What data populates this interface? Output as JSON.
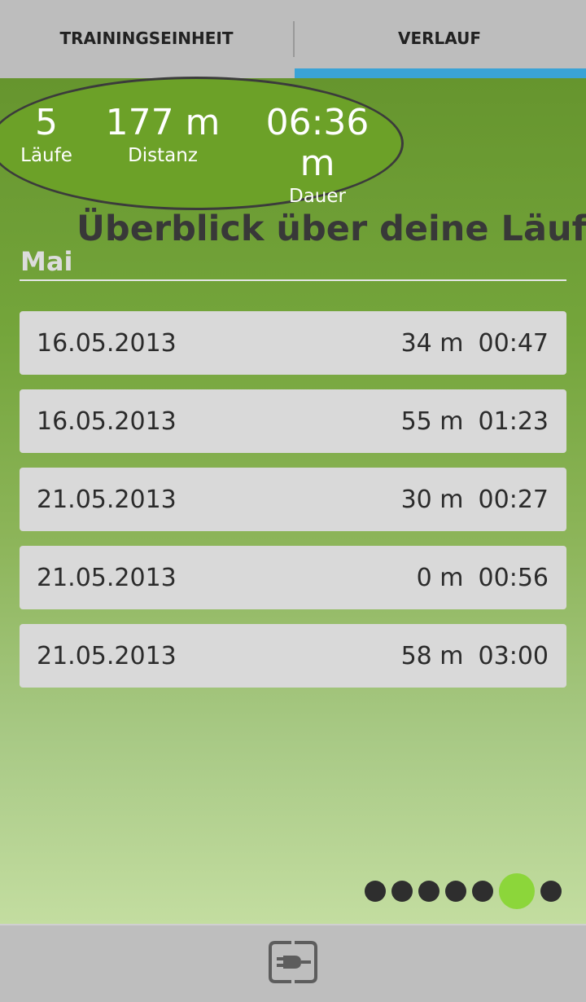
{
  "tabs": [
    {
      "label": "TRAININGSEINHEIT",
      "active": false
    },
    {
      "label": "VERLAUF",
      "active": true
    }
  ],
  "colors": {
    "accent": "#3aa3d6",
    "active_dot": "#8cd63a"
  },
  "summary": {
    "runs": {
      "value": "5",
      "label": "Läufe"
    },
    "distance": {
      "value": "177 m",
      "label": "Distanz"
    },
    "duration": {
      "value": "06:36 m",
      "label": "Dauer"
    }
  },
  "overlay_title": "Überblick über deine Läufe",
  "month": "Mai",
  "runs": [
    {
      "date": "16.05.2013",
      "distance": "34 m",
      "time": "00:47"
    },
    {
      "date": "16.05.2013",
      "distance": "55 m",
      "time": "01:23"
    },
    {
      "date": "21.05.2013",
      "distance": "30 m",
      "time": "00:27"
    },
    {
      "date": "21.05.2013",
      "distance": "0 m",
      "time": "00:56"
    },
    {
      "date": "21.05.2013",
      "distance": "58 m",
      "time": "03:00"
    }
  ],
  "pager": {
    "count": 7,
    "active_index": 5
  },
  "bottom_icon": "connect-plug-icon"
}
